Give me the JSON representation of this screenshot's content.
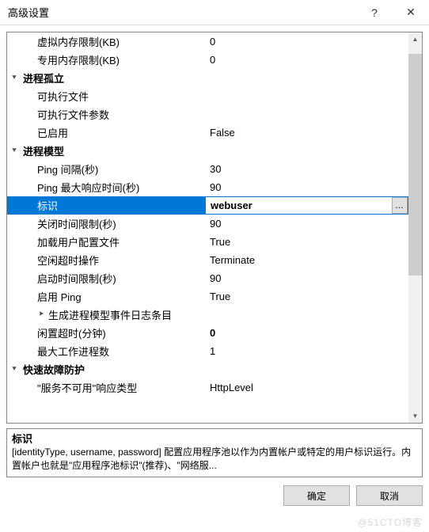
{
  "window": {
    "title": "高级设置",
    "help": "?",
    "close": "✕"
  },
  "rows": [
    {
      "type": "item",
      "label": "虚拟内存限制(KB)",
      "value": "0"
    },
    {
      "type": "item",
      "label": "专用内存限制(KB)",
      "value": "0"
    },
    {
      "type": "cat",
      "label": "进程孤立",
      "exp": "⯆"
    },
    {
      "type": "item",
      "label": "可执行文件",
      "value": ""
    },
    {
      "type": "item",
      "label": "可执行文件参数",
      "value": ""
    },
    {
      "type": "item",
      "label": "已启用",
      "value": "False"
    },
    {
      "type": "cat",
      "label": "进程模型",
      "exp": "⯆"
    },
    {
      "type": "item",
      "label": "Ping 间隔(秒)",
      "value": "30"
    },
    {
      "type": "item",
      "label": "Ping 最大响应时间(秒)",
      "value": "90"
    },
    {
      "type": "sel",
      "label": "标识",
      "value": "webuser"
    },
    {
      "type": "item",
      "label": "关闭时间限制(秒)",
      "value": "90"
    },
    {
      "type": "item",
      "label": "加载用户配置文件",
      "value": "True"
    },
    {
      "type": "item",
      "label": "空闲超时操作",
      "value": "Terminate"
    },
    {
      "type": "item",
      "label": "启动时间限制(秒)",
      "value": "90"
    },
    {
      "type": "item",
      "label": "启用 Ping",
      "value": "True"
    },
    {
      "type": "item",
      "label": "生成进程模型事件日志条目",
      "value": "",
      "exp": "⯈"
    },
    {
      "type": "item",
      "label": "闲置超时(分钟)",
      "value": "0",
      "bold": true
    },
    {
      "type": "item",
      "label": "最大工作进程数",
      "value": "1"
    },
    {
      "type": "cat",
      "label": "快速故障防护",
      "exp": "⯆"
    },
    {
      "type": "item",
      "label": "\"服务不可用\"响应类型",
      "value": "HttpLevel"
    }
  ],
  "desc": {
    "title": "标识",
    "text": "[identityType, username, password] 配置应用程序池以作为内置帐户或特定的用户标识运行。内置帐户也就是\"应用程序池标识\"(推荐)、\"网络服..."
  },
  "buttons": {
    "ok": "确定",
    "cancel": "取消"
  },
  "watermark": "@51CTO博客",
  "ellipsis": "..."
}
